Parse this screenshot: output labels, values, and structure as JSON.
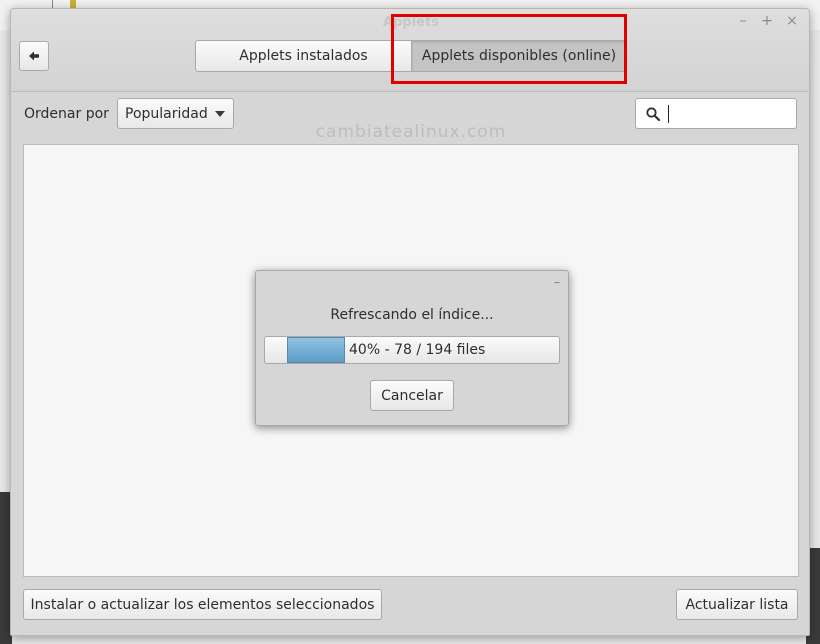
{
  "window": {
    "title": "Applets",
    "controls": {
      "minimize": "–",
      "maximize": "+",
      "close": "×"
    }
  },
  "tabs": [
    {
      "label": "Applets instalados",
      "active": false
    },
    {
      "label": "Applets disponibles (online)",
      "active": true
    }
  ],
  "toolbar": {
    "sort_label": "Ordenar por",
    "sort_value": "Popularidad",
    "search_value": ""
  },
  "watermark": "cambiatealinux.com",
  "dialog": {
    "minimize": "–",
    "message": "Refrescando el índice...",
    "progress_fraction": 0.4,
    "progress_text": "40% - 78 / 194 files",
    "cancel_label": "Cancelar"
  },
  "footer": {
    "install_label": "Instalar o actualizar los elementos seleccionados",
    "refresh_label": "Actualizar lista"
  },
  "colors": {
    "highlight": "#e10000",
    "progress_fill": "#6faad2"
  },
  "icons": [
    "back-arrow-icon",
    "search-icon",
    "dropdown-arrow-icon"
  ]
}
